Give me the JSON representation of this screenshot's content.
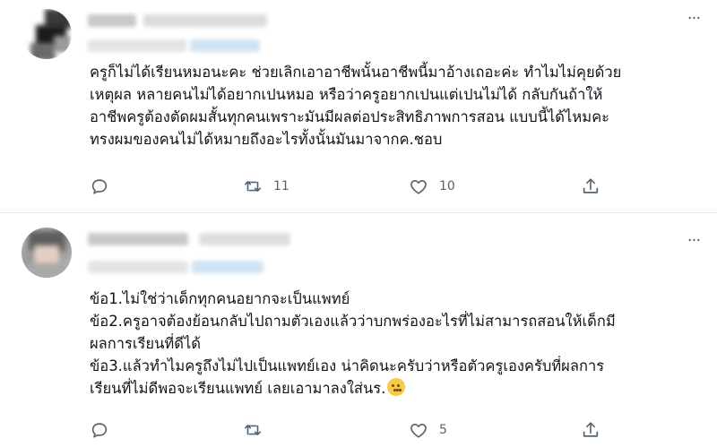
{
  "tweets": [
    {
      "text": "ครูก็ไม่ได้เรียนหมอนะคะ ช่วยเลิกเอาอาชีพนั้นอาชีพนี้มาอ้างเถอะค่ะ ทำไมไม่คุยด้วย\nเหตุผล หลายคนไม่ได้อยากเปนหมอ หรือว่าครูอยากเปนแต่เปนไม่ได้ กลับกันถ้าให้\nอาชีพครูต้องตัดผมสั้นทุกคนเพราะมันมีผลต่อประสิทธิภาพการสอน แบบนี้ได้ไหมคะ\nทรงผมของคนไม่ได้หมายถึงอะไรทั้งนั้นมันมาจากค.ชอบ",
      "actions": {
        "reply_count": "",
        "retweet_count": "11",
        "like_count": "10"
      }
    },
    {
      "text": "ข้อ1.ไม่ใช่ว่าเด็กทุกคนอยากจะเป็นแพทย์\nข้อ2.ครูอาจต้องย้อนกลับไปถามตัวเองแล้วว่าบกพร่องอะไรที่ไม่สามารถสอนให้เด็กมี\nผลการเรียนที่ดีได้\nข้อ3.แล้วทำไมครูถึงไม่ไปเป็นแพทย์เอง น่าคิดนะครับว่าหรือตัวครูเองครับที่ผลการ\nเรียนที่ไม่ดีพอจะเรียนแพทย์ เลยเอามาลงใส่นร.",
      "emoji": "thinking-face",
      "actions": {
        "reply_count": "",
        "retweet_count": "",
        "like_count": "5"
      }
    }
  ],
  "icons": {
    "more": "···",
    "reply": "reply-icon",
    "retweet": "retweet-icon",
    "like": "like-icon",
    "share": "share-icon"
  },
  "colors": {
    "text": "#0f1419",
    "secondary": "#536471",
    "divider": "#e4e8ec"
  }
}
